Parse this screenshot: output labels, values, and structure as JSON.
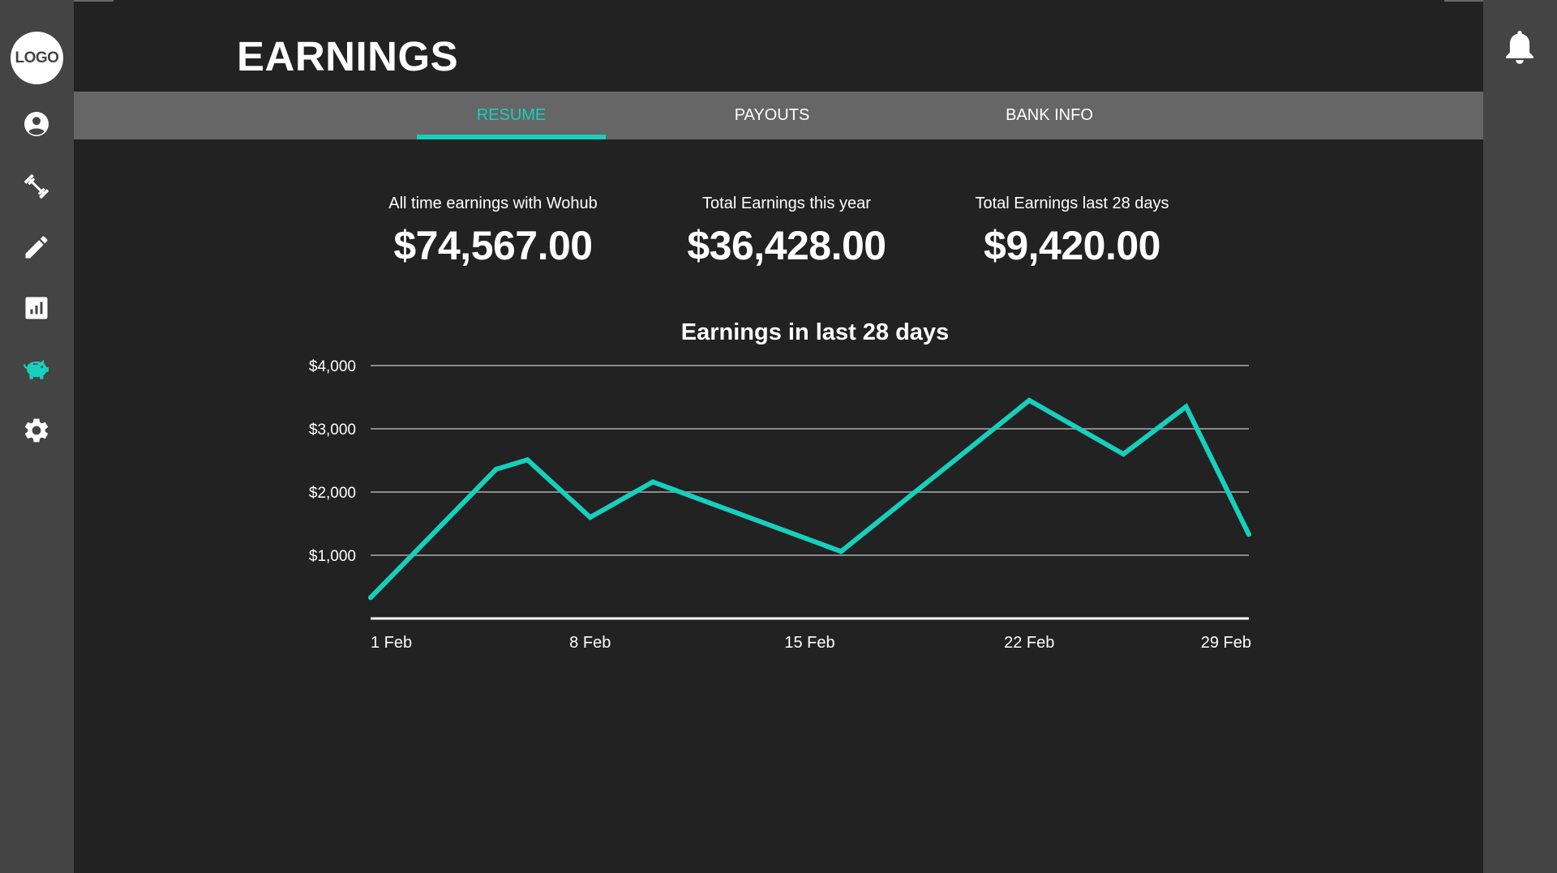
{
  "app": {
    "logo_text": "LOGO",
    "accent_color": "#17cfbd"
  },
  "sidebar": {
    "items": [
      {
        "icon": "profile-icon",
        "active": false
      },
      {
        "icon": "dumbbell-icon",
        "active": false
      },
      {
        "icon": "pencil-icon",
        "active": false
      },
      {
        "icon": "bar-chart-icon",
        "active": false
      },
      {
        "icon": "piggy-bank-icon",
        "active": true
      },
      {
        "icon": "gear-icon",
        "active": false
      }
    ]
  },
  "header": {
    "title": "EARNINGS",
    "notification_icon": "bell-icon"
  },
  "tabs": [
    {
      "label": "RESUME",
      "active": true
    },
    {
      "label": "PAYOUTS",
      "active": false
    },
    {
      "label": "BANK INFO",
      "active": false
    }
  ],
  "stats": [
    {
      "label": "All time earnings with Wohub",
      "value": "$74,567.00"
    },
    {
      "label": "Total Earnings this year",
      "value": "$36,428.00"
    },
    {
      "label": "Total Earnings last 28 days",
      "value": "$9,420.00"
    }
  ],
  "chart_data": {
    "type": "line",
    "title": "Earnings in last 28 days",
    "xlabel": "",
    "ylabel": "",
    "x_ticks": [
      "1 Feb",
      "8 Feb",
      "15 Feb",
      "22 Feb",
      "29 Feb"
    ],
    "y_ticks": [
      "$1,000",
      "$2,000",
      "$3,000",
      "$4,000"
    ],
    "xlim": [
      "1 Feb",
      "29 Feb"
    ],
    "ylim": [
      0,
      4000
    ],
    "grid": true,
    "color": "#17cfbd",
    "series": [
      {
        "x": [
          "1 Feb",
          "5 Feb",
          "6 Feb",
          "8 Feb",
          "10 Feb",
          "16 Feb",
          "22 Feb",
          "25 Feb",
          "27 Feb",
          "29 Feb"
        ],
        "values": [
          330,
          2360,
          2510,
          1600,
          2160,
          1060,
          3450,
          2600,
          3350,
          1330
        ]
      }
    ]
  }
}
